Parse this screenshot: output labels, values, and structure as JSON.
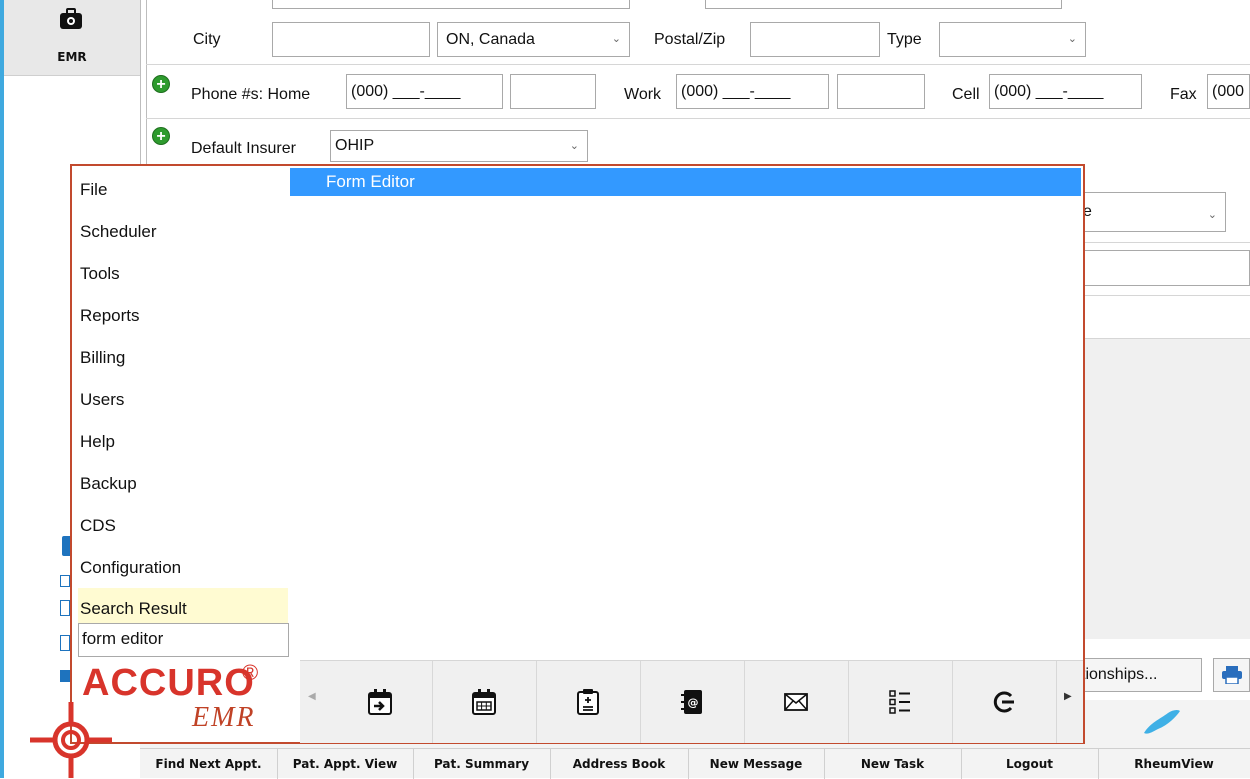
{
  "sidebar": {
    "emr_label": "EMR"
  },
  "address": {
    "city_label": "City",
    "province_value": "ON, Canada",
    "postal_label": "Postal/Zip",
    "type_label": "Type"
  },
  "phones": {
    "label": "Phone #s: Home",
    "home_value": "(000) ___-____",
    "work_label": "Work",
    "work_value": "(000) ___-____",
    "cell_label": "Cell",
    "cell_value": "(000) ___-____",
    "fax_label": "Fax",
    "fax_value": "(000"
  },
  "insurer": {
    "label": "Default Insurer",
    "value": "OHIP"
  },
  "background_partial": {
    "dropdown_fragment": "e",
    "relationships_button": "tionships..."
  },
  "popup": {
    "menu": [
      {
        "label": "File"
      },
      {
        "label": "Scheduler"
      },
      {
        "label": "Tools"
      },
      {
        "label": "Reports"
      },
      {
        "label": "Billing"
      },
      {
        "label": "Users"
      },
      {
        "label": "Help"
      },
      {
        "label": "Backup"
      },
      {
        "label": "CDS"
      },
      {
        "label": "Configuration"
      },
      {
        "label": "Search Result"
      }
    ],
    "search_value": "form editor",
    "results": [
      {
        "label": "Form Editor",
        "selected": true
      }
    ],
    "logo": {
      "brand": "ACCURO",
      "reg": "®",
      "sub": "EMR"
    },
    "dock_icons": [
      "appointment-import-icon",
      "calendar-icon",
      "clipboard-icon",
      "address-book-icon",
      "envelope-icon",
      "task-list-icon",
      "logout-icon"
    ]
  },
  "bottom_bar": {
    "items": [
      "Find Next Appt.",
      "Pat. Appt. View",
      "Pat. Summary",
      "Address Book",
      "New Message",
      "New Task",
      "Logout",
      "RheumView"
    ]
  },
  "colors": {
    "accent_blue": "#3fa9df",
    "selection_blue": "#3399ff",
    "popup_border": "#c24a2e",
    "logo_red": "#d8342b",
    "search_highlight": "#fffbd2",
    "add_green": "#2e9b2e"
  }
}
